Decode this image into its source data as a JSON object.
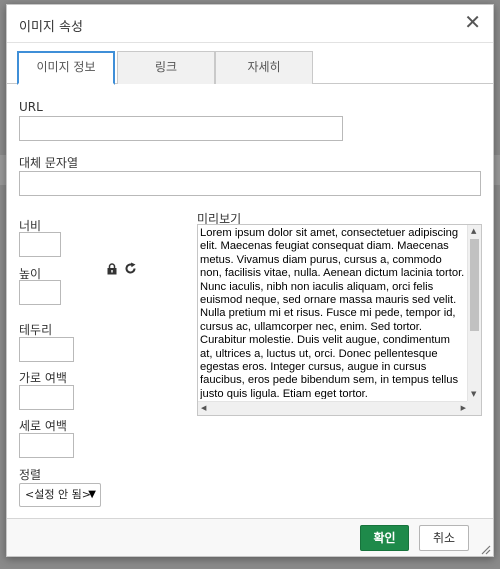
{
  "dialog": {
    "title": "이미지 속성",
    "close_glyph": "✕"
  },
  "tabs": [
    {
      "label": "이미지 정보",
      "active": true
    },
    {
      "label": "링크",
      "active": false
    },
    {
      "label": "자세히",
      "active": false
    }
  ],
  "fields": {
    "url_label": "URL",
    "url_value": "",
    "alt_label": "대체 문자열",
    "alt_value": "",
    "width_label": "너비",
    "width_value": "",
    "height_label": "높이",
    "height_value": "",
    "border_label": "테두리",
    "border_value": "",
    "hspace_label": "가로 여백",
    "hspace_value": "",
    "vspace_label": "세로 여백",
    "vspace_value": "",
    "align_label": "정렬",
    "align_value": "<설정 안 됨>"
  },
  "preview": {
    "label": "미리보기",
    "text": "Lorem ipsum dolor sit amet, consectetuer adipiscing elit. Maecenas feugiat consequat diam. Maecenas metus. Vivamus diam purus, cursus a, commodo non, facilisis vitae, nulla. Aenean dictum lacinia tortor. Nunc iaculis, nibh non iaculis aliquam, orci felis euismod neque, sed ornare massa mauris sed velit. Nulla pretium mi et risus. Fusce mi pede, tempor id, cursus ac, ullamcorper nec, enim. Sed tortor. Curabitur molestie. Duis velit augue, condimentum at, ultrices a, luctus ut, orci. Donec pellentesque egestas eros. Integer cursus, augue in cursus faucibus, eros pede bibendum sem, in tempus tellus justo quis ligula. Etiam eget tortor."
  },
  "footer": {
    "ok_label": "확인",
    "cancel_label": "취소"
  },
  "colors": {
    "ok": "#1e8a4a",
    "tab_active_border": "#3f8fd8"
  },
  "icons": {
    "lock": "lock-icon",
    "reset": "reset-icon",
    "close": "close-icon"
  }
}
